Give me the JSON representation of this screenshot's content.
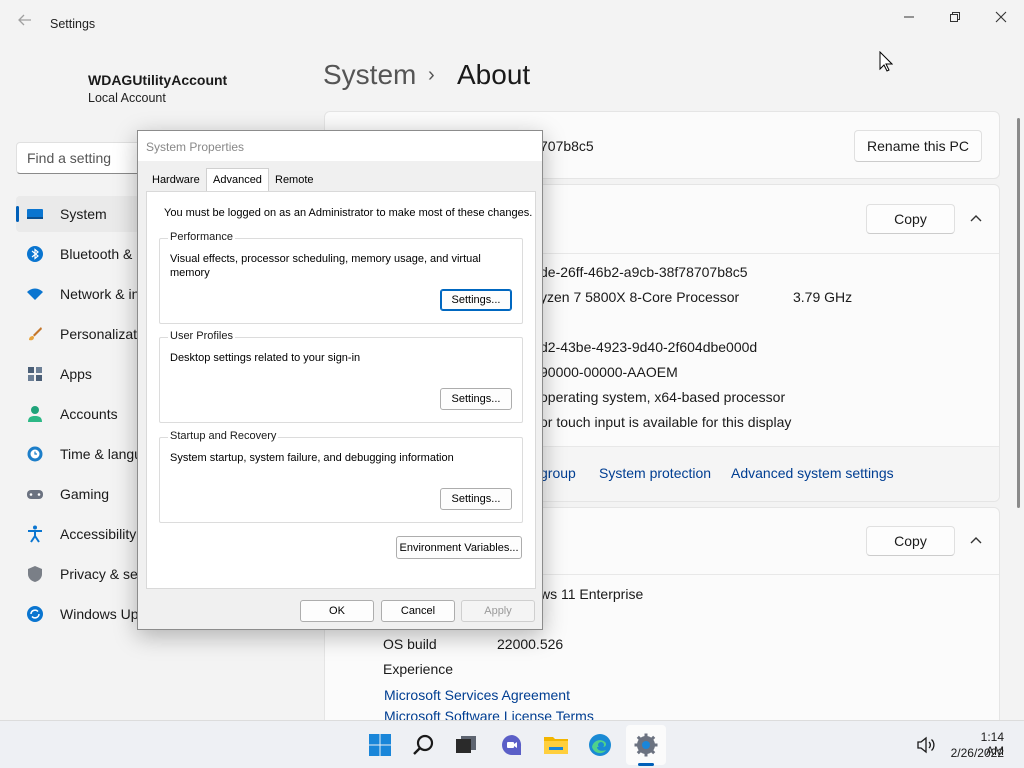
{
  "window": {
    "title": "Settings"
  },
  "profile": {
    "name": "WDAGUtilityAccount",
    "type": "Local Account"
  },
  "search": {
    "placeholder": "Find a setting"
  },
  "sidebar": {
    "items": [
      {
        "label": "System",
        "icon": "monitor-icon",
        "active": true
      },
      {
        "label": "Bluetooth & ",
        "icon": "bluetooth-icon"
      },
      {
        "label": "Network & in",
        "icon": "wifi-icon"
      },
      {
        "label": "Personalizati",
        "icon": "brush-icon"
      },
      {
        "label": "Apps",
        "icon": "apps-icon"
      },
      {
        "label": "Accounts",
        "icon": "person-icon"
      },
      {
        "label": "Time & langu",
        "icon": "clock-globe-icon"
      },
      {
        "label": "Gaming",
        "icon": "gamepad-icon"
      },
      {
        "label": "Accessibility",
        "icon": "accessibility-icon"
      },
      {
        "label": "Privacy & sec",
        "icon": "shield-icon"
      },
      {
        "label": "Windows Up",
        "icon": "update-icon"
      }
    ]
  },
  "breadcrumb": {
    "parent": "System",
    "separator": "›",
    "current": "About"
  },
  "device_header": {
    "name_fragment": "707b8c5",
    "rename_button": "Rename this PC"
  },
  "device_specs": {
    "copy_button": "Copy",
    "rows": [
      "de-26ff-46b2-a9cb-38f78707b8c5",
      "yzen 7 5800X 8-Core Processor",
      "3.79 GHz",
      "d2-43be-4923-9d40-2f604dbe000d",
      "90000-00000-AAOEM",
      "operating system, x64-based processor",
      " or touch input is available for this display"
    ],
    "links": [
      "group",
      "System protection",
      "Advanced system settings"
    ]
  },
  "windows_specs": {
    "copy_button": "Copy",
    "edition_fragment": "ws 11 Enterprise",
    "os_build_label": "OS build",
    "os_build_value": "22000.526",
    "experience_label": "Experience",
    "links": [
      "Microsoft Services Agreement",
      "Microsoft Software License Terms"
    ]
  },
  "dialog": {
    "title": "System Properties",
    "tabs": [
      "Hardware",
      "Advanced",
      "Remote"
    ],
    "notice": "You must be logged on as an Administrator to make most of these changes.",
    "performance": {
      "title": "Performance",
      "line1": "Visual effects, processor scheduling, memory usage, and virtual",
      "line2": "memory",
      "button": "Settings..."
    },
    "user_profiles": {
      "title": "User Profiles",
      "desc": "Desktop settings related to your sign-in",
      "button": "Settings..."
    },
    "startup_recovery": {
      "title": "Startup and Recovery",
      "desc": "System startup, system failure, and debugging information",
      "button": "Settings..."
    },
    "env_button": "Environment Variables...",
    "ok": "OK",
    "cancel": "Cancel",
    "apply": "Apply"
  },
  "taskbar": {
    "icons": [
      "start-icon",
      "search-icon",
      "task-view-icon",
      "chat-icon",
      "file-explorer-icon",
      "edge-icon",
      "settings-icon"
    ],
    "time": "1:14 AM",
    "date": "2/26/2022"
  },
  "colors": {
    "accent": "#005fb8",
    "link": "#003e92"
  }
}
